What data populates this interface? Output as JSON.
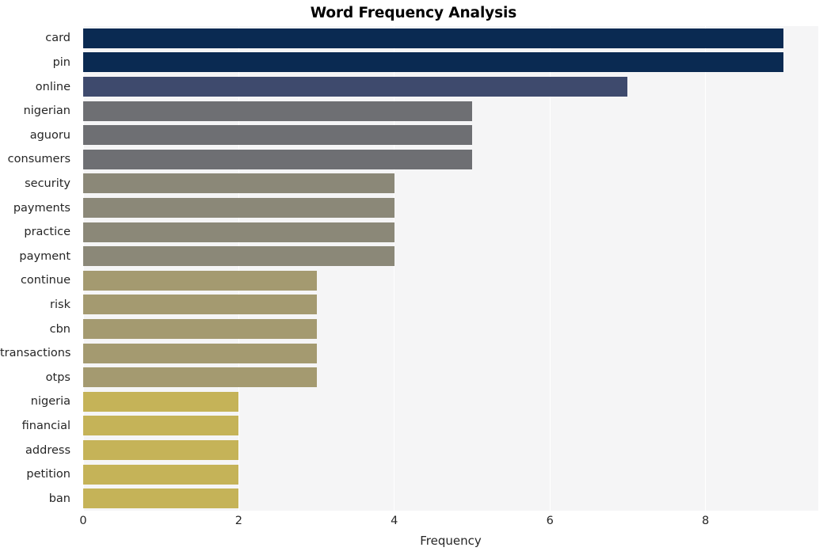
{
  "chart_data": {
    "type": "bar",
    "orientation": "horizontal",
    "title": "Word Frequency Analysis",
    "xlabel": "Frequency",
    "ylabel": "",
    "categories": [
      "card",
      "pin",
      "online",
      "nigerian",
      "aguoru",
      "consumers",
      "security",
      "payments",
      "practice",
      "payment",
      "continue",
      "risk",
      "cbn",
      "transactions",
      "otps",
      "nigeria",
      "financial",
      "address",
      "petition",
      "ban"
    ],
    "values": [
      9,
      9,
      7,
      5,
      5,
      5,
      4,
      4,
      4,
      4,
      3,
      3,
      3,
      3,
      3,
      2,
      2,
      2,
      2,
      2
    ],
    "bar_colors": [
      "#0a2a52",
      "#0a2a52",
      "#3e4a6d",
      "#6e6f73",
      "#6e6f73",
      "#6e6f73",
      "#8b8878",
      "#8b8878",
      "#8b8878",
      "#8b8878",
      "#a49a70",
      "#a49a70",
      "#a49a70",
      "#a49a70",
      "#a49a70",
      "#c5b358",
      "#c5b358",
      "#c5b358",
      "#c5b358",
      "#c5b358"
    ],
    "xlim": [
      0,
      9.45
    ],
    "xticks": [
      0,
      2,
      4,
      6,
      8
    ],
    "xtick_labels": [
      "0",
      "2",
      "4",
      "6",
      "8"
    ],
    "grid": "vertical",
    "legend": "none",
    "plot_background": "#f5f5f6",
    "gridline_color": "#ffffff",
    "figure_background": "#ffffff",
    "text_color": "#262626"
  }
}
